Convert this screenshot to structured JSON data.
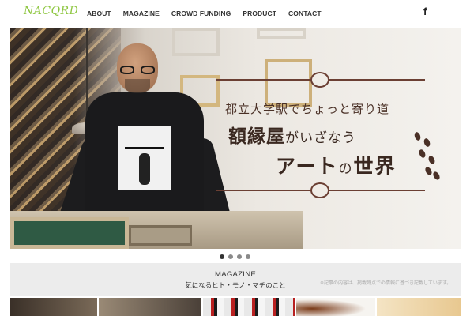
{
  "header": {
    "logo": "NACQRD",
    "nav": [
      "ABOUT",
      "MAGAZINE",
      "CROWD FUNDING",
      "PRODUCT",
      "CONTACT"
    ],
    "social_icon": "facebook-icon",
    "social_glyph": "f"
  },
  "hero": {
    "subtitle": "都立大学駅でちょっと寄り道",
    "line1_main": "額縁屋",
    "line1_rest": "がいざなう",
    "line2_a": "アート",
    "line2_b": "の",
    "line2_c": "世界",
    "slides_total": 4,
    "active_slide": 1
  },
  "magazine": {
    "title": "MAGAZINE",
    "subtitle": "気になるヒト・モノ・マチのこと",
    "note": "※記事の内容は、掲載時点での情報に基づき記載しています。"
  },
  "colors": {
    "logo": "#8dc63f",
    "hero_text": "#3a2820",
    "band": "#ececec"
  }
}
